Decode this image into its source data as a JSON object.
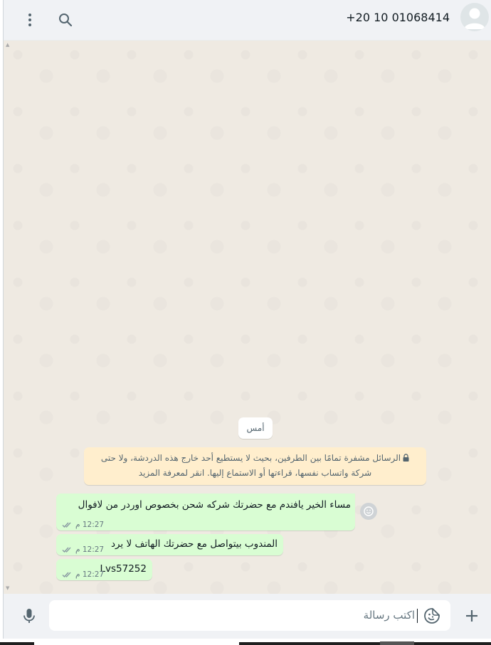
{
  "header": {
    "contact_name": "+20 10 01068414",
    "menu_icon": "kebab-menu-icon",
    "search_icon": "search-icon",
    "avatar_icon": "default-avatar-icon"
  },
  "chat": {
    "date_divider": "أمس",
    "encryption_notice": {
      "icon": "lock-icon",
      "line1": "الرسائل مشفرة تمامًا بين الطرفين، بحيث لا يستطيع أحد خارج هذه الدردشة، ولا حتى",
      "line2": "شركة واتساب نفسها، قراءتها أو الاستماع إليها. انقر لمعرفة المزيد"
    },
    "messages": [
      {
        "text": "مساء الخير يافندم مع حضرتك شركه شحن بخصوص اوردر من لافوال",
        "time": "12:27 م",
        "status": "sent-double-tick"
      },
      {
        "text": "المندوب بيتواصل مع حضرتك الهاتف لا يرد",
        "time": "12:27 م",
        "status": "sent-double-tick"
      },
      {
        "text": "Lvs57252",
        "time": "12:27 م",
        "status": "sent-double-tick"
      }
    ]
  },
  "composer": {
    "placeholder": "اكتب رسالة",
    "mic_icon": "microphone-icon",
    "sticker_icon": "sticker-icon",
    "attach_icon": "plus-icon"
  },
  "colors": {
    "outgoing_bubble": "#d9fdd3",
    "notice_bg": "#ffeecd",
    "chat_bg": "#efeae2",
    "header_bg": "#f0f2f5"
  }
}
